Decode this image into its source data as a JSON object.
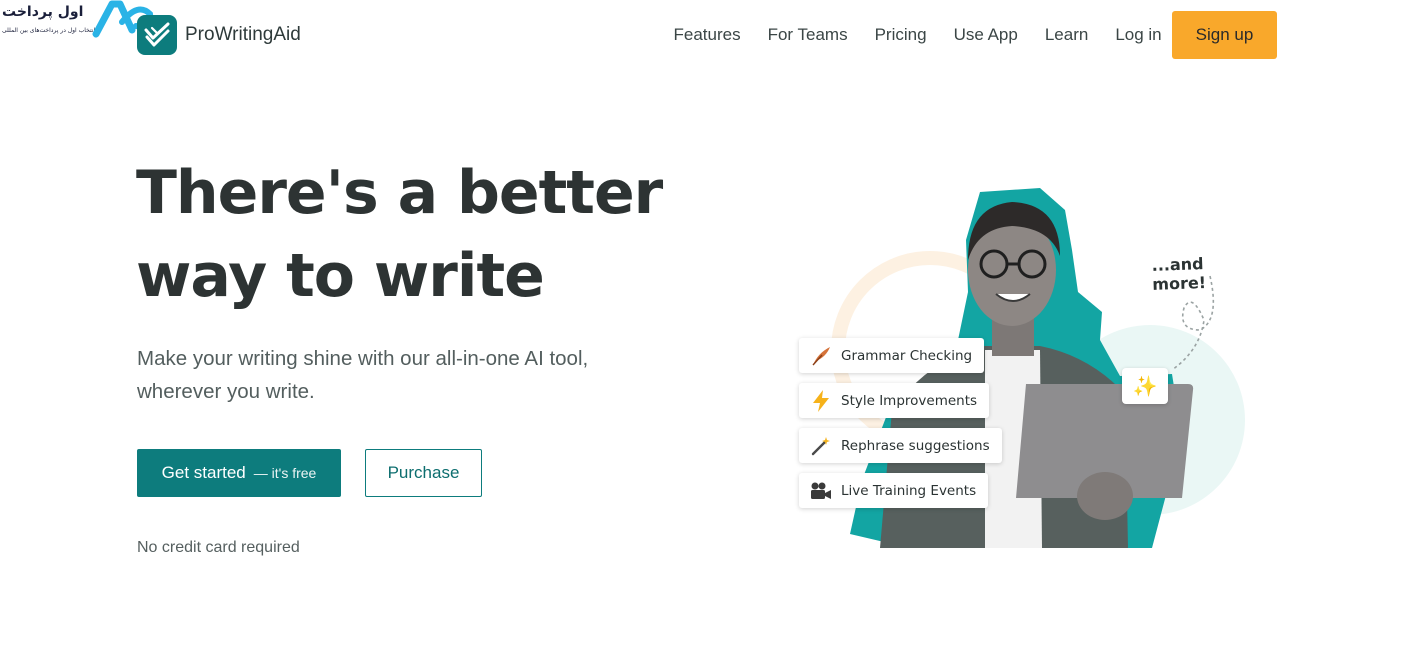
{
  "watermark": {
    "text": "اول پرداخت",
    "subtext": "انتخاب اول در پرداخت‌های بین المللی"
  },
  "header": {
    "brand": "ProWritingAid",
    "nav": [
      "Features",
      "For Teams",
      "Pricing",
      "Use App",
      "Learn",
      "Log in"
    ],
    "signup": "Sign up"
  },
  "hero": {
    "title_line1": "There's a better",
    "title_line2": "way to write",
    "subtitle_line1": "Make your writing shine with our all-in-one AI tool,",
    "subtitle_line2": "wherever you write.",
    "primary_cta": "Get started",
    "primary_cta_suffix": "— it's free",
    "secondary_cta": "Purchase",
    "note": "No credit card required"
  },
  "illustration": {
    "more_label": "...and more!",
    "features": [
      {
        "label": "Grammar Checking",
        "icon": "quill-icon"
      },
      {
        "label": "Style Improvements",
        "icon": "lightning-icon"
      },
      {
        "label": "Rephrase suggestions",
        "icon": "magic-wand-icon"
      },
      {
        "label": "Live Training Events",
        "icon": "video-camera-icon"
      }
    ]
  },
  "colors": {
    "brand_teal": "#0d7c7d",
    "signup_orange": "#f9a82b",
    "text_dark": "#2d3333"
  }
}
